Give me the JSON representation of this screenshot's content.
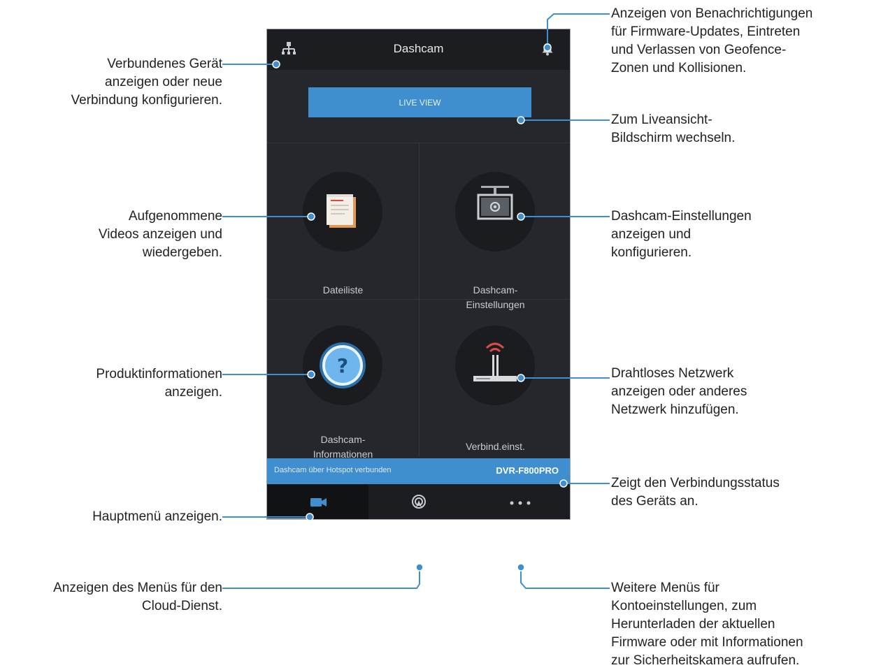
{
  "app": {
    "title": "Dashcam",
    "live_view_label": "LIVE VIEW",
    "tiles": [
      {
        "label": "Dateiliste"
      },
      {
        "label": "Dashcam-\nEinstellungen"
      },
      {
        "label": "Dashcam-\nInformationen"
      },
      {
        "label": "Verbind.einst."
      }
    ],
    "status": {
      "text": "Dashcam über Hotspot verbunden",
      "device_id": "DVR-F800PRO"
    },
    "nav": [
      {
        "icon": "video-camera-icon",
        "active": true
      },
      {
        "icon": "cloud-signal-icon",
        "active": false
      },
      {
        "icon": "more-dots-icon",
        "active": false
      }
    ]
  },
  "annotations": {
    "connected_device": "Verbundenes Gerät\nanzeigen oder neue\nVerbindung konfigurieren.",
    "notifications": "Anzeigen von Benachrichtigungen\nfür Firmware-Updates, Eintreten\nund Verlassen von Geofence-\nZonen und Kollisionen.",
    "live_view": "Zum Liveansicht-\nBildschirm wechseln.",
    "recorded_videos": "Aufgenommene\nVideos anzeigen und\nwiedergeben.",
    "dashcam_settings": "Dashcam-Einstellungen\nanzeigen und\nkonfigurieren.",
    "product_info": "Produktinformationen\nanzeigen.",
    "wireless_network": "Drahtloses Netzwerk\nanzeigen oder anderes\nNetzwerk hinzufügen.",
    "connection_status": "Zeigt den Verbindungsstatus\ndes Geräts an.",
    "main_menu": "Hauptmenü anzeigen.",
    "cloud_menu": "Anzeigen des Menüs für den\nCloud-Dienst.",
    "more_menus": "Weitere Menüs für\nKontoeinstellungen, zum\nHerunterladen der aktuellen\nFirmware oder mit Informationen\nzur Sicherheitskamera aufrufen."
  },
  "colors": {
    "accent": "#3f8fd0",
    "screen_bg": "#24272b",
    "leader_line": "#3f8fd0"
  }
}
